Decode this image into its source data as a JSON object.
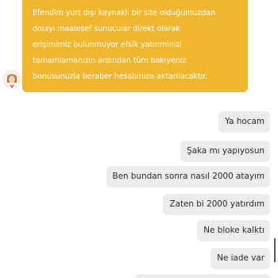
{
  "agent_message": {
    "lines": [
      "Efendim yurt dışı kaynaklı bir site olduğumuzdan",
      "dolayı maalesef sunucular direkt olarak",
      "erişimimiz bulunmuyor efsik yatırıminizi",
      "tamamlamanızın ardından tüm bakiyeniz",
      "bonusunuzla beraber hesabınıza aktarılacaktır."
    ]
  },
  "user_messages": [
    "Ya hocam",
    "Şaka mı yapıyosun",
    "Ben bundan sonra nasıl 2000 atayım",
    "Zaten bi 2000 yatırdım",
    "Ne bloke kalktı",
    "Ne iade var"
  ],
  "colors": {
    "agent_bubble": "#f0b62d",
    "user_bubble": "#ececec"
  }
}
